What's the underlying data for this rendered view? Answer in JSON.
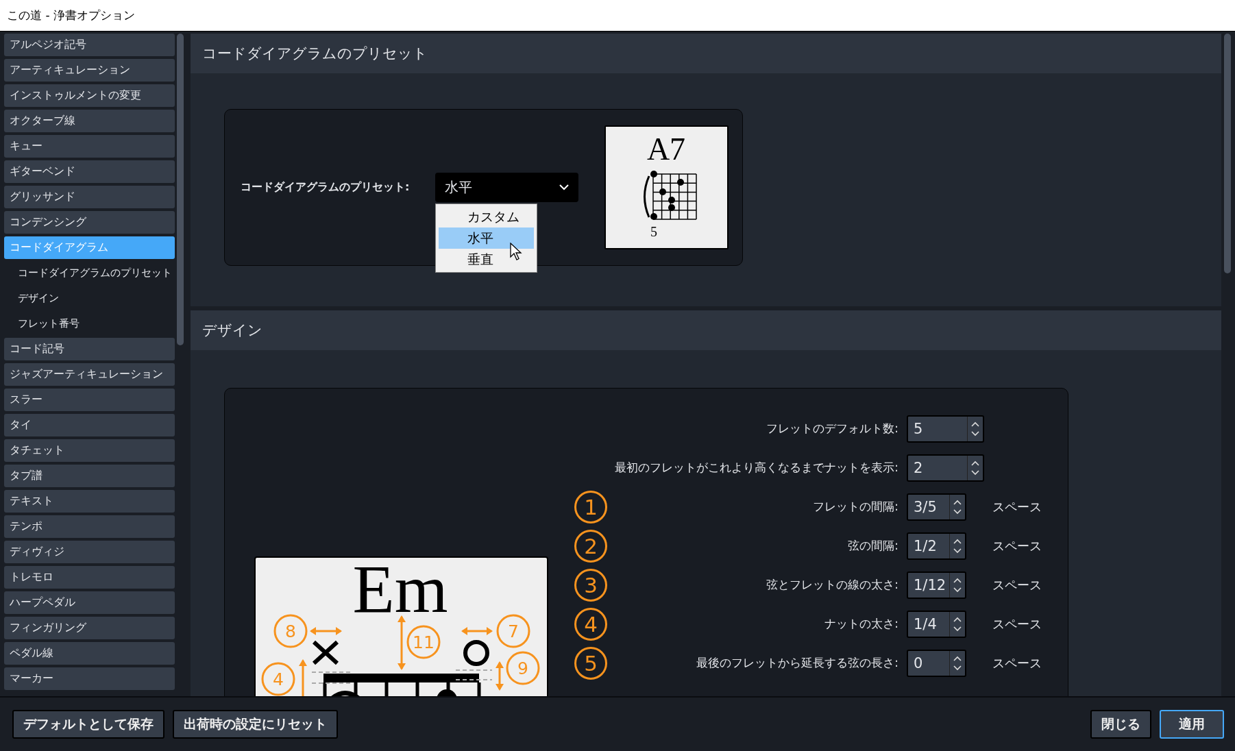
{
  "window": {
    "title": "この道 - 浄書オプション"
  },
  "sidebar": {
    "items": [
      {
        "label": "アルペジオ記号",
        "selected": false
      },
      {
        "label": "アーティキュレーション",
        "selected": false
      },
      {
        "label": "インストゥルメントの変更",
        "selected": false
      },
      {
        "label": "オクターブ線",
        "selected": false
      },
      {
        "label": "キュー",
        "selected": false
      },
      {
        "label": "ギターベンド",
        "selected": false
      },
      {
        "label": "グリッサンド",
        "selected": false
      },
      {
        "label": "コンデンシング",
        "selected": false
      },
      {
        "label": "コードダイアグラム",
        "selected": true,
        "children": [
          {
            "label": "コードダイアグラムのプリセット"
          },
          {
            "label": "デザイン"
          },
          {
            "label": "フレット番号"
          }
        ]
      },
      {
        "label": "コード記号",
        "selected": false
      },
      {
        "label": "ジャズアーティキュレーション",
        "selected": false
      },
      {
        "label": "スラー",
        "selected": false
      },
      {
        "label": "タイ",
        "selected": false
      },
      {
        "label": "タチェット",
        "selected": false
      },
      {
        "label": "タブ譜",
        "selected": false
      },
      {
        "label": "テキスト",
        "selected": false
      },
      {
        "label": "テンポ",
        "selected": false
      },
      {
        "label": "ディヴィジ",
        "selected": false
      },
      {
        "label": "トレモロ",
        "selected": false
      },
      {
        "label": "ハープペダル",
        "selected": false
      },
      {
        "label": "フィンガリング",
        "selected": false
      },
      {
        "label": "ペダル線",
        "selected": false
      },
      {
        "label": "マーカー",
        "selected": false
      }
    ]
  },
  "preset_section": {
    "title": "コードダイアグラムのプリセット",
    "label": "コードダイアグラムのプリセット:",
    "value": "水平",
    "options": [
      {
        "label": "カスタム",
        "selected": false
      },
      {
        "label": "水平",
        "selected": true
      },
      {
        "label": "垂直",
        "selected": false
      }
    ],
    "preview": {
      "chord": "A7",
      "fret": "5"
    }
  },
  "design_section": {
    "title": "デザイン",
    "diagram": {
      "chord": "Em",
      "callouts": [
        "8",
        "11",
        "7",
        "4",
        "9"
      ]
    },
    "fields": [
      {
        "label": "フレットのデフォルト数:",
        "value": "5"
      },
      {
        "label": "最初のフレットがこれより高くなるまでナットを表示:",
        "value": "2"
      },
      {
        "marker": "1",
        "label": "フレットの間隔:",
        "value": "3/5",
        "unit": "スペース"
      },
      {
        "marker": "2",
        "label": "弦の間隔:",
        "value": "1/2",
        "unit": "スペース"
      },
      {
        "marker": "3",
        "label": "弦とフレットの線の太さ:",
        "value": "1/12",
        "unit": "スペース"
      },
      {
        "marker": "4",
        "label": "ナットの太さ:",
        "value": "1/4",
        "unit": "スペース"
      },
      {
        "marker": "5",
        "label": "最後のフレットから延長する弦の長さ:",
        "value": "0",
        "unit": "スペース"
      }
    ]
  },
  "footer": {
    "left_buttons": [
      {
        "label": "デフォルトとして保存",
        "focused": false
      },
      {
        "label": "出荷時の設定にリセット",
        "focused": false
      }
    ],
    "right_buttons": [
      {
        "label": "閉じる",
        "focused": false
      },
      {
        "label": "適用",
        "focused": true
      }
    ]
  }
}
